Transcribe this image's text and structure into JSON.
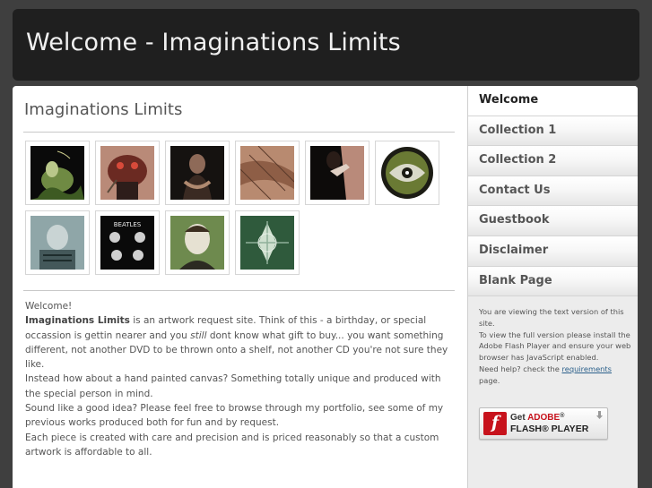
{
  "header": {
    "title": "Welcome - Imaginations Limits"
  },
  "main": {
    "heading": "Imaginations Limits",
    "intro": {
      "greeting": "Welcome!",
      "site_name": "Imaginations Limits",
      "p1_after_name": " is an artwork request site. Think of this - a birthday, or special occassion is gettin nearer and you ",
      "p1_italic": "still",
      "p1_end": " dont know what gift to buy... you want something different, not another DVD to be thrown onto a shelf, not another CD you're not sure they like.",
      "p2": "Instead how about a hand painted canvas? Something totally unique and produced with the special person in mind.",
      "p3": "Sound like a good idea? Please feel free to browse through my portfolio, see some of my previous works produced both for fun and by request.",
      "p4": "Each piece is created with care and precision and is priced reasonably so that a custom artwork is affordable to all."
    }
  },
  "gallery": {
    "thumbnails": [
      {
        "name": "thumb-1"
      },
      {
        "name": "thumb-2"
      },
      {
        "name": "thumb-3"
      },
      {
        "name": "thumb-4"
      },
      {
        "name": "thumb-5"
      },
      {
        "name": "thumb-6"
      },
      {
        "name": "thumb-7"
      },
      {
        "name": "thumb-8"
      },
      {
        "name": "thumb-9"
      },
      {
        "name": "thumb-10"
      }
    ]
  },
  "nav": {
    "items": [
      {
        "label": "Welcome",
        "active": true
      },
      {
        "label": "Collection 1"
      },
      {
        "label": "Collection 2"
      },
      {
        "label": "Contact Us"
      },
      {
        "label": "Guestbook"
      },
      {
        "label": "Disclaimer"
      },
      {
        "label": "Blank Page"
      }
    ]
  },
  "sidebar": {
    "text_version": "You are viewing the text version of this site.",
    "install_text": "To view the full version please install the Adobe Flash Player and ensure your web browser has JavaScript enabled.",
    "help_prefix": "Need help? check the ",
    "help_link": "requirements",
    "help_suffix": " page."
  },
  "flash_badge": {
    "line1_get": "Get ",
    "line1_brand": "ADOBE",
    "line1_reg": "®",
    "line2": "FLASH® PLAYER",
    "logo_letter": "f",
    "icon": "download-arrow-icon"
  },
  "colors": {
    "header_bg": "#1f1f1f",
    "page_bg": "#3f3f3f",
    "flash_red": "#c7121c"
  }
}
